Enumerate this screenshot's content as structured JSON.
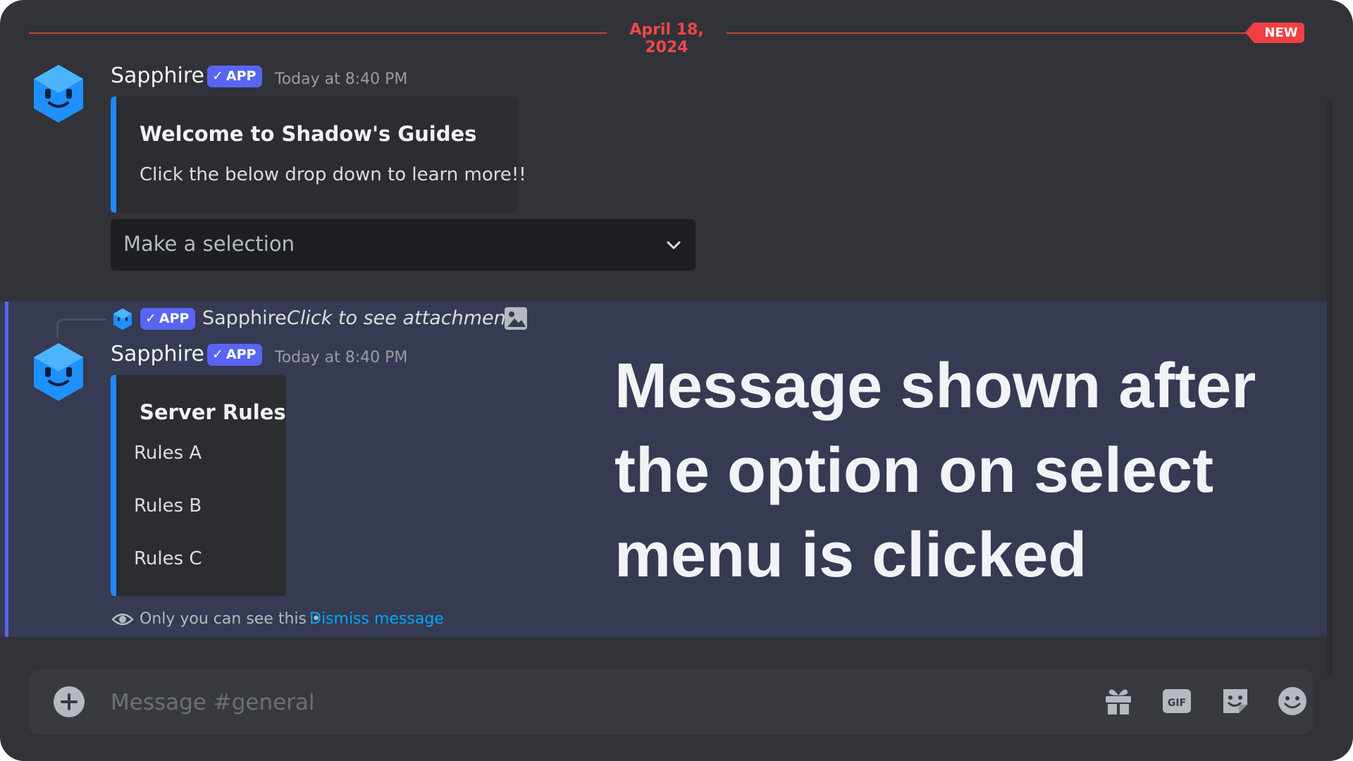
{
  "date_divider": {
    "date": "April 18, 2024",
    "new_badge": "NEW"
  },
  "messages": [
    {
      "author": "Sapphire",
      "tag": "APP",
      "timestamp": "Today at 8:40 PM",
      "embed": {
        "title": "Welcome to Shadow's Guides",
        "description": "Click the below drop down to learn more!!"
      },
      "select_menu": {
        "placeholder": "Make a selection"
      }
    },
    {
      "reply": {
        "tag": "APP",
        "author": "Sapphire",
        "preview": "Click to see attachment"
      },
      "author": "Sapphire",
      "tag": "APP",
      "timestamp": "Today at 8:40 PM",
      "embed": {
        "title": "Server Rules",
        "lines": [
          "Rules A",
          "Rules B",
          "Rules C"
        ]
      },
      "ephemeral": {
        "notice": "Only you can see this •",
        "dismiss": "Dismiss message"
      }
    }
  ],
  "overlay_caption": "Message shown after the option on select menu is clicked",
  "composer": {
    "placeholder": "Message #general",
    "icons": [
      "plus-circle-icon",
      "gift-icon",
      "gif-icon",
      "sticker-icon",
      "emoji-icon"
    ]
  },
  "colors": {
    "background": "#313338",
    "accent": "#5865f2",
    "embed_bar": "#1e88ff",
    "new_red": "#f23f43",
    "link": "#00a8fc"
  }
}
